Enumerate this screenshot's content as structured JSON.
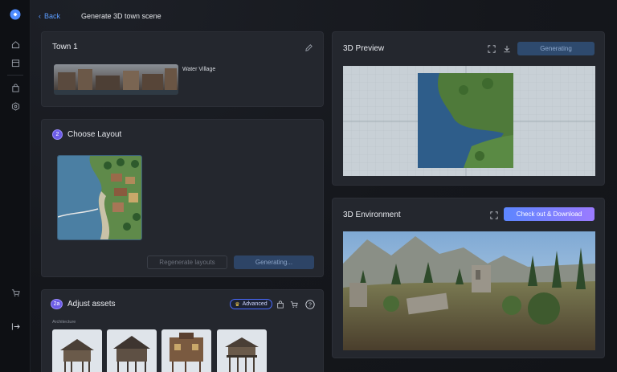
{
  "header": {
    "back_label": "Back",
    "title": "Generate 3D town scene"
  },
  "town_card": {
    "title": "Town 1",
    "banner_label": "Water Village"
  },
  "layout_card": {
    "step": "2",
    "title": "Choose Layout",
    "regen_label": "Regenerate layouts",
    "generating_label": "Generating..."
  },
  "assets_card": {
    "step": "2a",
    "title": "Adjust assets",
    "advanced_label": "Advanced",
    "section_label": "Architecture"
  },
  "preview_card": {
    "title": "3D Preview",
    "generating_label": "Generating"
  },
  "environment_card": {
    "title": "3D Environment",
    "checkout_label": "Check out & Download"
  },
  "colors": {
    "accent": "#5b9cff",
    "brand_gradient": [
      "#5c86ff",
      "#9b7bff"
    ],
    "card_bg": "#24272e"
  }
}
